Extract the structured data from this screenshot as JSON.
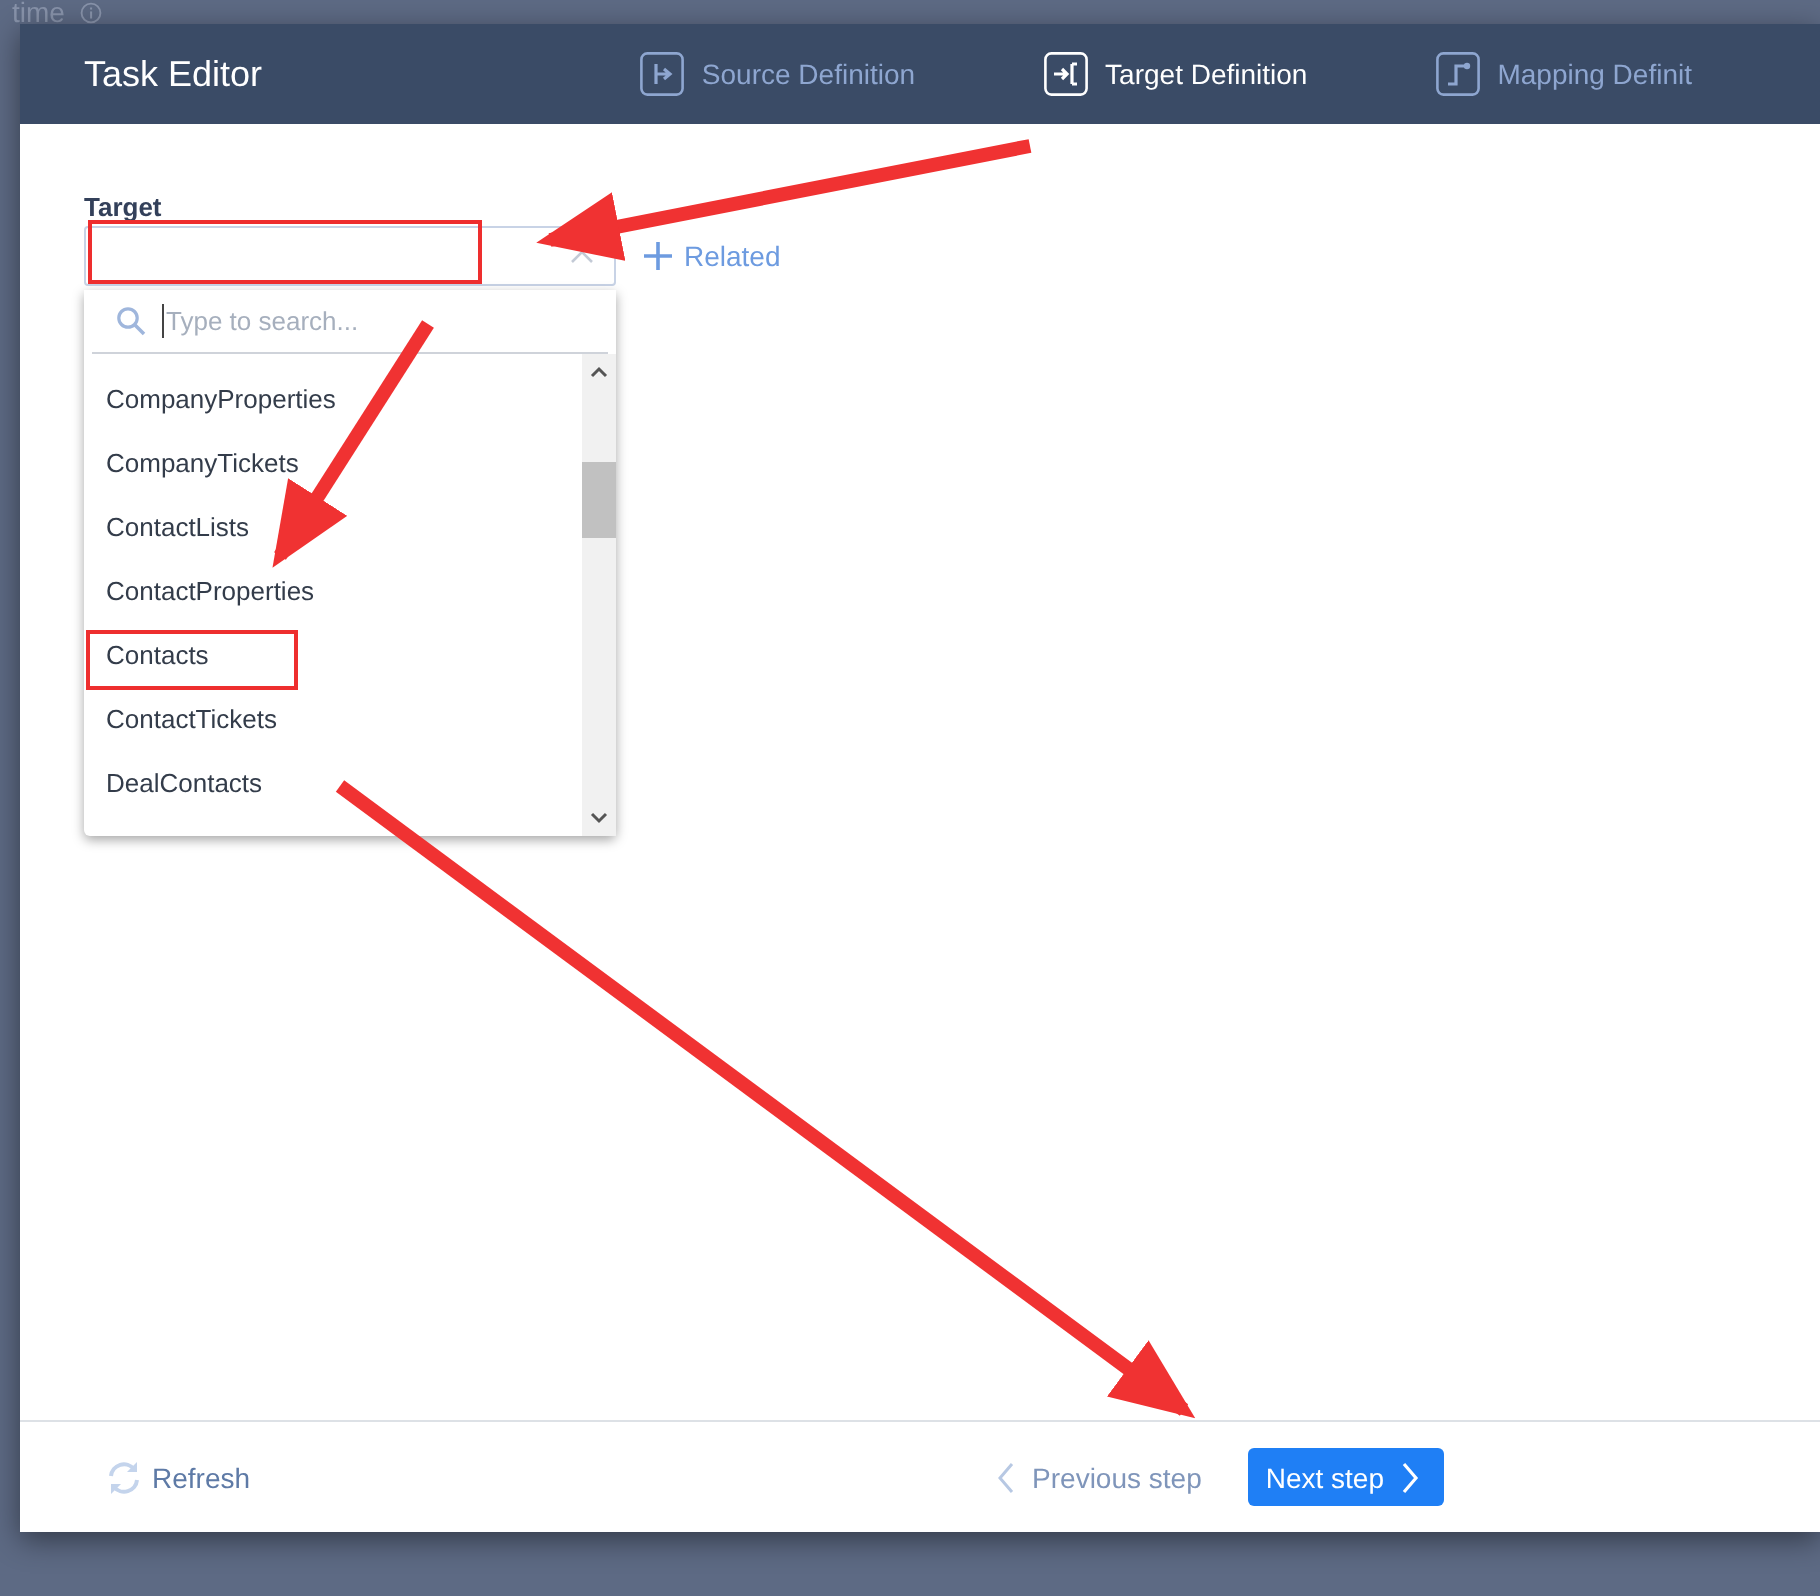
{
  "background": {
    "top_text": "time"
  },
  "dialog": {
    "title": "Task Editor",
    "steps": [
      {
        "kind": "source",
        "label": "Source Definition",
        "selected": false
      },
      {
        "kind": "target",
        "label": "Target Definition",
        "selected": true
      },
      {
        "kind": "mapping",
        "label": "Mapping Definit",
        "selected": false
      }
    ],
    "target": {
      "label": "Target",
      "related": "Related",
      "dropdown": {
        "search": {
          "placeholder": "Type to search..."
        },
        "options": [
          {
            "label": "CompanyProperties"
          },
          {
            "label": "CompanyTickets"
          },
          {
            "label": "ContactLists"
          },
          {
            "label": "ContactProperties"
          },
          {
            "label": "Contacts"
          },
          {
            "label": "ContactTickets"
          },
          {
            "label": "DealContacts"
          }
        ]
      }
    }
  },
  "footer": {
    "refresh": "Refresh",
    "previous": "Previous step",
    "next": "Next step"
  }
}
